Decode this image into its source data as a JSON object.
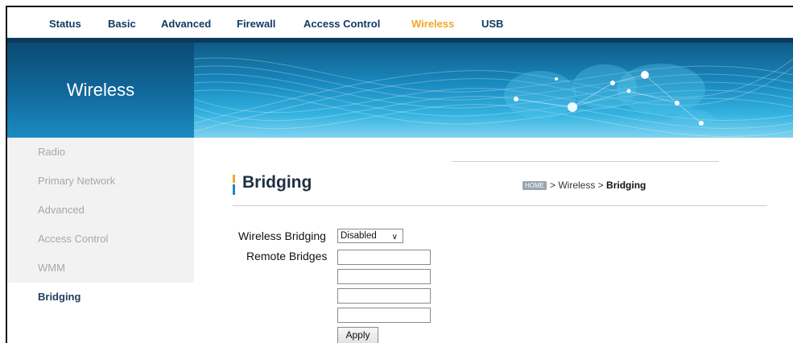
{
  "nav": {
    "items": [
      {
        "label": "Status"
      },
      {
        "label": "Basic"
      },
      {
        "label": "Advanced"
      },
      {
        "label": "Firewall"
      },
      {
        "label": "Access Control"
      },
      {
        "label": "Wireless"
      },
      {
        "label": "USB"
      }
    ],
    "active": "Wireless"
  },
  "banner": {
    "title": "Wireless"
  },
  "sidebar": {
    "items": [
      {
        "label": "Radio"
      },
      {
        "label": "Primary Network"
      },
      {
        "label": "Advanced"
      },
      {
        "label": "Access Control"
      },
      {
        "label": "WMM"
      },
      {
        "label": "Bridging"
      }
    ],
    "active": "Bridging"
  },
  "page": {
    "title": "Bridging",
    "breadcrumb": {
      "home_badge": "HOME",
      "middle": "> Wireless >",
      "current": "Bridging"
    }
  },
  "form": {
    "bridging_label": "Wireless Bridging",
    "bridging_value": "Disabled",
    "remote_label": "Remote Bridges",
    "remote_bridges": [
      "",
      "",
      "",
      ""
    ],
    "apply_label": "Apply"
  },
  "colors": {
    "nav_text": "#123a66",
    "nav_active": "#f5a623",
    "banner_dark": "#0b4a73",
    "banner_light": "#33b2e0",
    "sidebar_bg": "#f2f2f2",
    "sidebar_text": "#a8a8a8",
    "sidebar_active": "#1f3d5c"
  }
}
